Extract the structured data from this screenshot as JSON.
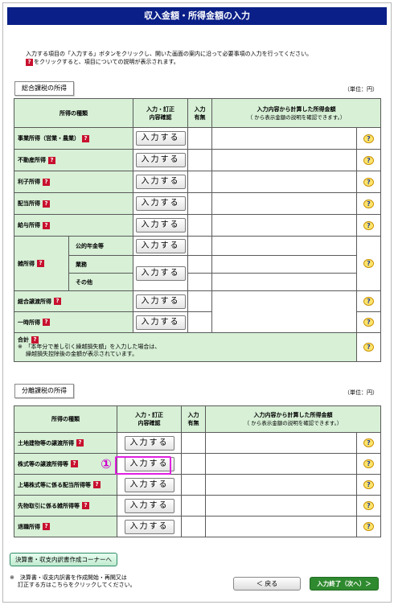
{
  "title": "収入金額・所得金額の入力",
  "intro": {
    "line1": "入力する項目の「入力する」ボタンをクリックし、開いた画面の案内に沿って必要事項の入力を行ってください。",
    "line2": "をクリックすると、項目についての説明が表示されます。"
  },
  "help_badge": "?",
  "q_icon": "?",
  "unit": "（単位：円）",
  "input_button": "入力する",
  "comprehensive": {
    "label": "総合課税の所得",
    "headers": {
      "kind": "所得の種類",
      "confirm": "入力・訂正\n内容確認",
      "presence": "入力\n有無",
      "amount1": "入力内容から計算した所得金額",
      "amount2": "（ から表示金額の説明を確認できます。）"
    },
    "rows": [
      "事業所得（営業・農業）",
      "不動産所得",
      "利子所得",
      "配当所得",
      "給与所得"
    ],
    "misc": {
      "label": "雑所得",
      "sub1": "公的年金等",
      "sub2": "業務",
      "sub3": "その他"
    },
    "rows2": [
      "総合譲渡所得",
      "一時所得"
    ],
    "total": {
      "label": "合計",
      "note1": "※　「本年分で差し引く繰越損失額」を入力した場合は、",
      "note2": "繰越損失控除後の金額が表示されています。"
    }
  },
  "separate": {
    "label": "分離課税の所得",
    "headers": {
      "kind": "所得の種類",
      "confirm": "入力・訂正\n内容確認",
      "presence": "入力\n有無",
      "amount1": "入力内容から計算した所得金額",
      "amount2": "（ から表示金額の説明を確認できます。）"
    },
    "rows": [
      "土地建物等の譲渡所得",
      "株式等の譲渡所得等",
      "上場株式等に係る配当所得等",
      "先物取引に係る雑所得等",
      "退職所得"
    ]
  },
  "marker": "①",
  "settlement_button": "決算書・収支内訳書作成コーナーへ",
  "footnote1": "※　決算書・収支内訳書を作成開始・再開又は",
  "footnote2": "訂正する方はこちらをクリックしてください。",
  "back_button": "＜ 戻る",
  "next_button": "入力終了（次へ）＞",
  "colors": {
    "title_bg": "#0a1f87",
    "header_bg": "#d7f0d6",
    "help_badge": "#c8102e",
    "highlight": "#e020e0",
    "next_button": "#2f8a2f"
  }
}
